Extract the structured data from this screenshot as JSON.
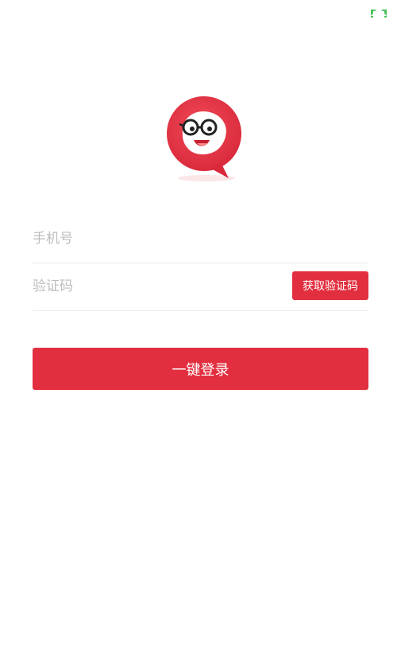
{
  "header": {
    "corner_icon": "fullscreen-expand-icon"
  },
  "logo": {
    "icon": "chat-bubble-mascot-logo",
    "brand_color": "#e22f3f"
  },
  "form": {
    "phone_placeholder": "手机号",
    "phone_value": "",
    "code_placeholder": "验证码",
    "code_value": "",
    "get_code_label": "获取验证码",
    "login_label": "一键登录"
  },
  "colors": {
    "accent": "#e22f3f",
    "placeholder": "#bdbdbd",
    "divider": "#ececec"
  }
}
